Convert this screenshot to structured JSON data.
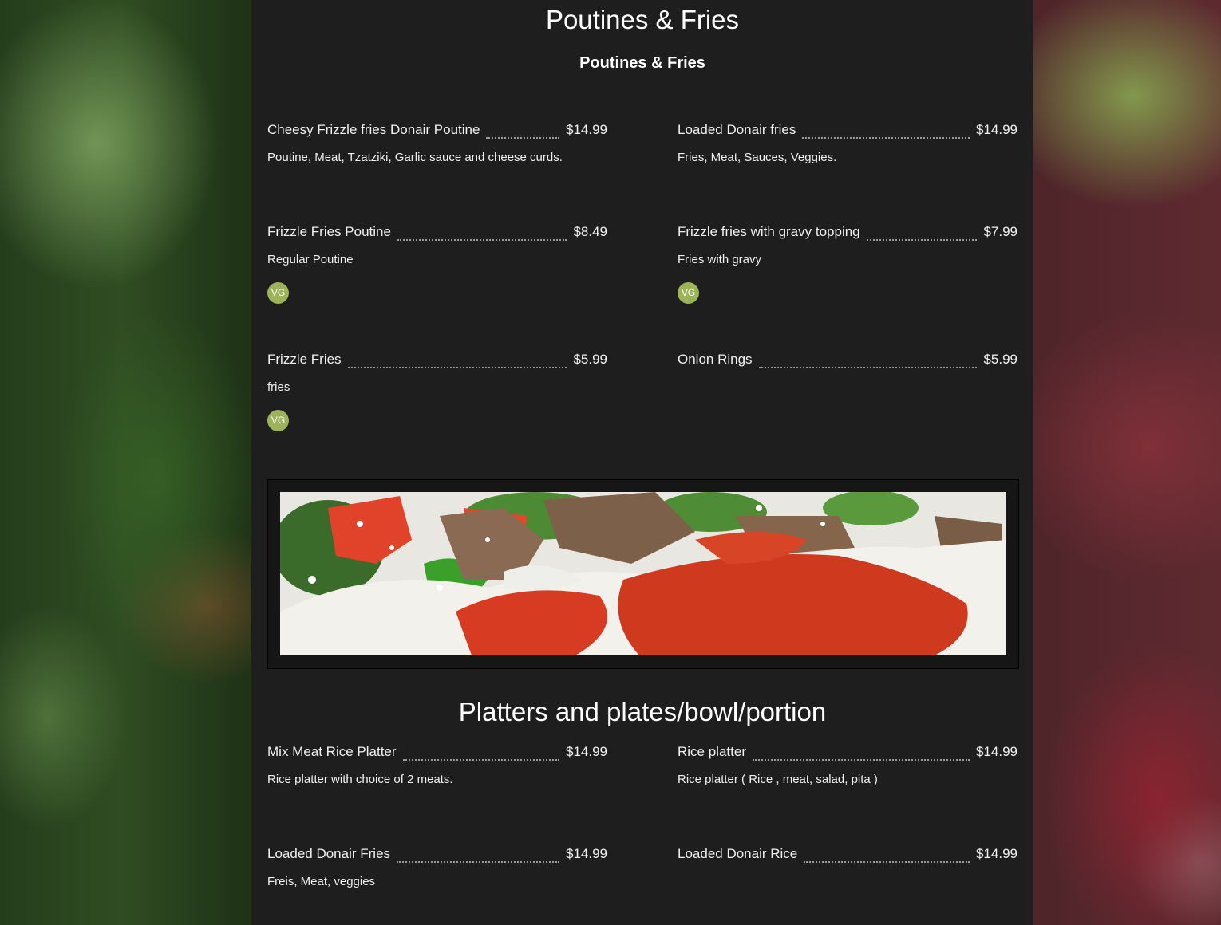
{
  "sections": [
    {
      "title": "Poutines & Fries",
      "subtitle": "Poutines & Fries",
      "items": [
        {
          "name": "Cheesy Frizzle fries Donair Poutine",
          "price": "$14.99",
          "description": "Poutine, Meat, Tzatziki, Garlic sauce and cheese curds."
        },
        {
          "name": "Loaded Donair fries",
          "price": "$14.99",
          "description": "Fries, Meat, Sauces, Veggies."
        },
        {
          "name": "Frizzle Fries Poutine",
          "price": "$8.49",
          "description": "Regular Poutine",
          "badge": "VG"
        },
        {
          "name": "Frizzle fries with gravy topping",
          "price": "$7.99",
          "description": "Fries with gravy",
          "badge": "VG"
        },
        {
          "name": "Frizzle Fries",
          "price": "$5.99",
          "description": "fries",
          "badge": "VG"
        },
        {
          "name": "Onion Rings",
          "price": "$5.99"
        }
      ]
    },
    {
      "title": "Platters and plates/bowl/portion",
      "items": [
        {
          "name": "Mix Meat Rice Platter",
          "price": "$14.99",
          "description": "Rice platter with choice of 2 meats."
        },
        {
          "name": "Rice platter",
          "price": "$14.99",
          "description": "Rice platter ( Rice , meat, salad, pita )"
        },
        {
          "name": "Loaded Donair Fries",
          "price": "$14.99",
          "description": "Freis, Meat, veggies"
        },
        {
          "name": "Loaded Donair Rice",
          "price": "$14.99"
        }
      ]
    }
  ],
  "colors": {
    "panel_background": "#1e1e1e",
    "vegetarian_badge": "#9cb457",
    "text": "#ffffff"
  },
  "icons": {
    "vegetarian_badge": "vg-badge-icon"
  }
}
